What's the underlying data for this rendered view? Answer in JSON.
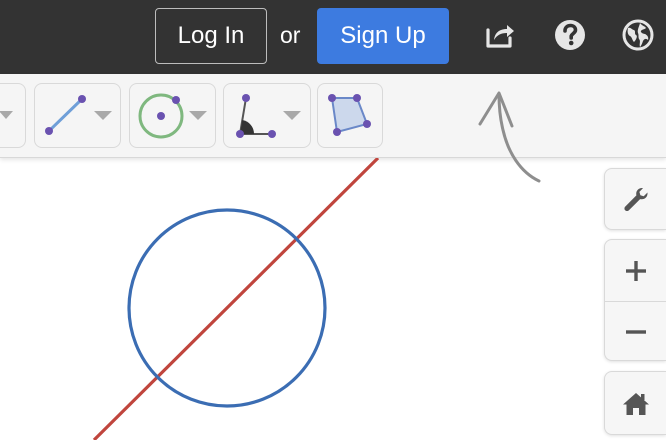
{
  "header": {
    "login_label": "Log In",
    "or_label": "or",
    "signup_label": "Sign Up",
    "icons": [
      "share-icon",
      "help-icon",
      "globe-icon"
    ]
  },
  "toolbar": {
    "tools": [
      "segment-tool",
      "circle-tool",
      "angle-tool",
      "polygon-tool"
    ]
  },
  "controls": {
    "icons": [
      "wrench-icon",
      "zoom-in-icon",
      "zoom-out-icon",
      "home-icon"
    ]
  },
  "colors": {
    "header_bg": "#333333",
    "signup_bg": "#3d7be0",
    "circle_stroke": "#3b6db3",
    "line_stroke": "#c0453d",
    "tool_point": "#6a52b0",
    "circle_tool_stroke": "#7fb87f"
  }
}
